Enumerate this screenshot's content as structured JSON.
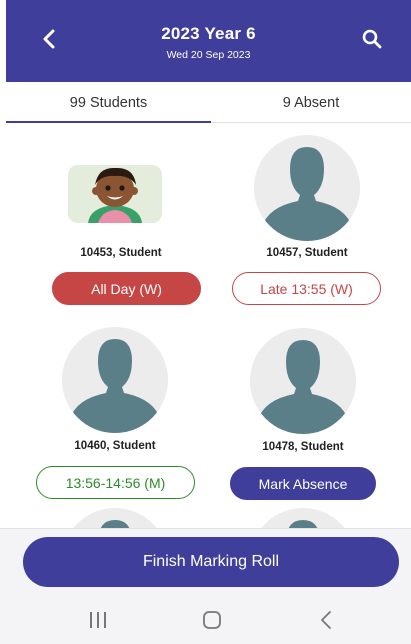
{
  "header": {
    "title": "2023 Year 6",
    "subtitle": "Wed 20 Sep 2023",
    "back_icon": "chevron-left-icon",
    "search_icon": "search-icon"
  },
  "tabs": {
    "students": "99 Students",
    "absent": "9 Absent",
    "active": "students"
  },
  "students": [
    {
      "name": "10453, Student",
      "status": "All Day (W)",
      "status_style": "absent-all-day",
      "photo": "child-photo"
    },
    {
      "name": "10457, Student",
      "status": "Late 13:55 (W)",
      "status_style": "late",
      "photo": "placeholder"
    },
    {
      "name": "10460, Student",
      "status": "13:56-14:56 (M)",
      "status_style": "partial",
      "photo": "placeholder"
    },
    {
      "name": "10478, Student",
      "status": "Mark Absence",
      "status_style": "mark-absence",
      "photo": "placeholder"
    }
  ],
  "footer": {
    "finish_label": "Finish Marking Roll"
  },
  "system_nav": {
    "recents_icon": "recents-icon",
    "home_icon": "home-icon",
    "back_icon": "back-icon"
  },
  "colors": {
    "primary": "#3f3f9b",
    "absent_red": "#c64545",
    "partial_green": "#2e8b2e",
    "avatar_teal": "#5b7f88"
  }
}
